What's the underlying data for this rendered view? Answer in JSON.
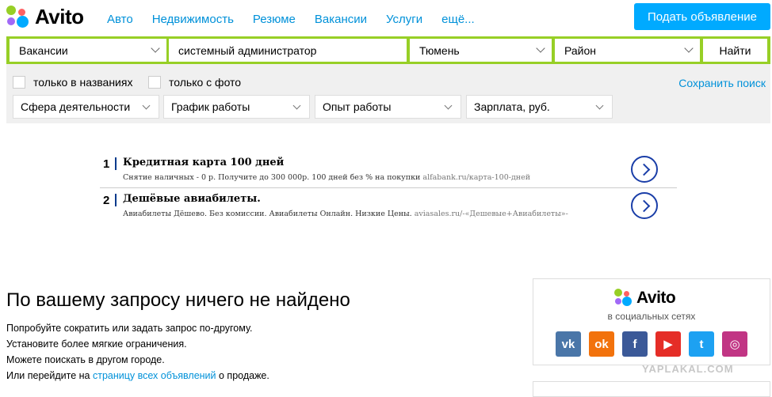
{
  "header": {
    "brand": "Avito",
    "nav": [
      "Авто",
      "Недвижимость",
      "Резюме",
      "Вакансии",
      "Услуги",
      "ещё..."
    ],
    "post_button": "Подать объявление",
    "colors": {
      "accent": "#00aaff",
      "link": "#0091d9",
      "search_border": "#97cf26"
    }
  },
  "search": {
    "category": "Вакансии",
    "query": "системный администратор",
    "city": "Тюмень",
    "district": "Район",
    "find_button": "Найти"
  },
  "filters": {
    "checkbox_titles_only": "только в названиях",
    "checkbox_with_photo": "только с фото",
    "save_search": "Сохранить поиск",
    "dropdowns": [
      "Сфера деятельности",
      "График работы",
      "Опыт работы",
      "Зарплата, руб."
    ]
  },
  "ads": [
    {
      "num": "1",
      "title": "Кредитная карта 100 дней",
      "desc": "Снятие наличных - 0 р. Получите до 300 000р. 100 дней без % на покупки",
      "url": "alfabank.ru/карта-100-дней",
      "icon": "chevron-right-circle-icon"
    },
    {
      "num": "2",
      "title": "Дешёвые авиабилеты.",
      "desc": "Авиабилеты Дёшево. Без комиссии. Авиабилеты Онлайн. Низкие Цены.",
      "url": "aviasales.ru/-«Дешевые+Авиабилеты»-",
      "icon": "chevron-right-circle-icon"
    }
  ],
  "not_found": {
    "title": "По вашему запросу ничего не найдено",
    "lines": [
      "Попробуйте сократить или задать запрос по-другому.",
      "Установите более мягкие ограничения.",
      "Можете поискать в другом городе."
    ],
    "last_prefix": "Или перейдите на",
    "last_link": "страницу всех объявлений",
    "last_suffix": "о продаже."
  },
  "social": {
    "brand": "Avito",
    "subtitle": "в социальных сетях",
    "icons": [
      {
        "name": "vk-icon",
        "glyph": "vk",
        "color": "#4a76a8"
      },
      {
        "name": "odnoklassniki-icon",
        "glyph": "ok",
        "color": "#f2720c"
      },
      {
        "name": "facebook-icon",
        "glyph": "f",
        "color": "#3b5998"
      },
      {
        "name": "youtube-icon",
        "glyph": "▶",
        "color": "#e52d27"
      },
      {
        "name": "twitter-icon",
        "glyph": "t",
        "color": "#1da1f2"
      },
      {
        "name": "instagram-icon",
        "glyph": "◎",
        "color": "#c13584"
      }
    ]
  },
  "watermark": "YAPLAKAL.COM"
}
